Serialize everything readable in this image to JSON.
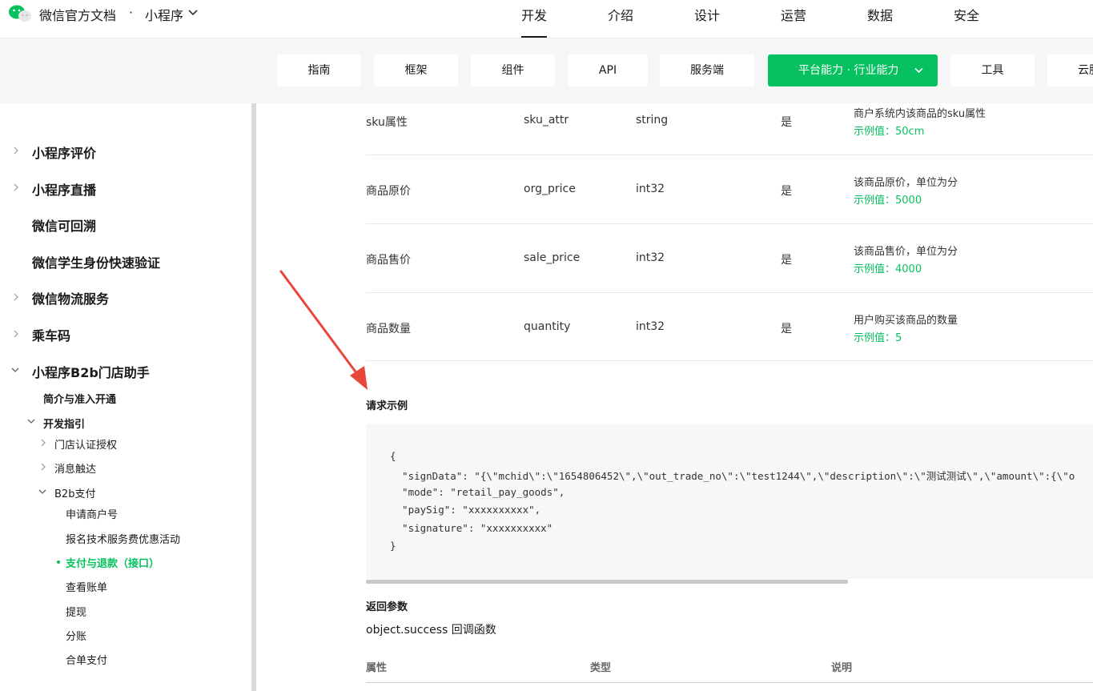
{
  "header": {
    "brand": "微信官方文档",
    "separator": "·",
    "product": "小程序",
    "nav": [
      "开发",
      "介绍",
      "设计",
      "运营",
      "数据",
      "安全"
    ]
  },
  "subnav": {
    "tabs": [
      "指南",
      "框架",
      "组件",
      "API",
      "服务端",
      "平台能力 · 行业能力",
      "工具",
      "云服"
    ]
  },
  "sidebar": {
    "top_items": [
      {
        "label": "小程序评价",
        "arrow": true
      },
      {
        "label": "小程序直播",
        "arrow": true
      },
      {
        "label": "微信可回溯",
        "arrow": false
      },
      {
        "label": "微信学生身份快速验证",
        "arrow": false
      },
      {
        "label": "微信物流服务",
        "arrow": true
      },
      {
        "label": "乘车码",
        "arrow": true
      },
      {
        "label": "小程序B2b门店助手",
        "arrow": "open"
      }
    ],
    "intro": "简介与准入开通",
    "dev_guide": "开发指引",
    "guide_items": [
      "门店认证授权",
      "消息触达",
      "B2b支付"
    ],
    "pay_items": [
      "申请商户号",
      "报名技术服务费优惠活动",
      "支付与退款（接口）",
      "查看账单",
      "提现",
      "分账",
      "合单支付"
    ]
  },
  "table": {
    "rows": [
      {
        "name": "sku属性",
        "field": "sku_attr",
        "type": "string",
        "required": "是",
        "desc": "商户系统内该商品的sku属性",
        "example": "示例值：50cm"
      },
      {
        "name": "商品原价",
        "field": "org_price",
        "type": "int32",
        "required": "是",
        "desc": "该商品原价，单位为分",
        "example": "示例值：5000"
      },
      {
        "name": "商品售价",
        "field": "sale_price",
        "type": "int32",
        "required": "是",
        "desc": "该商品售价，单位为分",
        "example": "示例值：4000"
      },
      {
        "name": "商品数量",
        "field": "quantity",
        "type": "int32",
        "required": "是",
        "desc": "用户购买该商品的数量",
        "example": "示例值：5"
      }
    ]
  },
  "request_example": {
    "title": "请求示例",
    "code": [
      "{",
      "  \"signData\": \"{\\\"mchid\\\":\\\"1654806452\\\",\\\"out_trade_no\\\":\\\"test1244\\\",\\\"description\\\":\\\"测试测试\\\",\\\"amount\\\":{\\\"o",
      "  \"mode\": \"retail_pay_goods\",",
      "  \"paySig\": \"xxxxxxxxxx\",",
      "  \"signature\": \"xxxxxxxxxx\"",
      "}"
    ]
  },
  "return_params": {
    "title": "返回参数",
    "callback": "object.success 回调函数",
    "columns": [
      "属性",
      "类型",
      "说明"
    ]
  },
  "colors": {
    "accent": "#07c160",
    "annotation_arrow": "#e8463a"
  }
}
